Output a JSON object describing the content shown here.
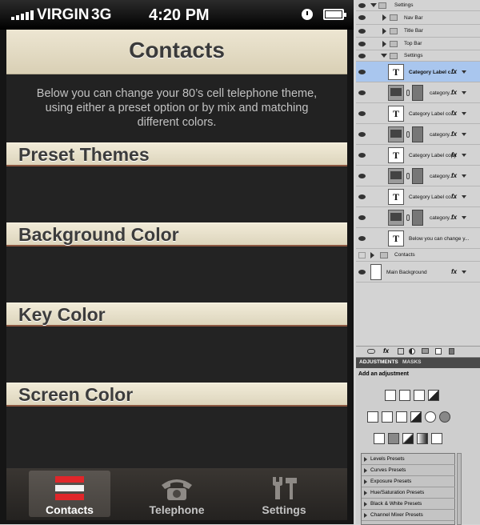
{
  "status_bar": {
    "carrier": "VIRGIN",
    "network": "3G",
    "time": "4:20 PM"
  },
  "nav_bar": {
    "title": "Contacts"
  },
  "intro_text": "Below you can change your 80’s cell telephone theme, using either a preset option or by mix and matching different colors.",
  "categories": [
    {
      "label": "Preset Themes"
    },
    {
      "label": "Background Color"
    },
    {
      "label": "Key Color"
    },
    {
      "label": "Screen Color"
    }
  ],
  "tab_bar": {
    "tabs": [
      {
        "label": "Contacts",
        "icon": "contacts-icon",
        "active": true
      },
      {
        "label": "Telephone",
        "icon": "telephone-icon",
        "active": false
      },
      {
        "label": "Settings",
        "icon": "settings-tools-icon",
        "active": false
      }
    ]
  },
  "layers_panel": {
    "rows": [
      {
        "label": "Settings"
      },
      {
        "label": "Nav Bar"
      },
      {
        "label": "Title Bar"
      },
      {
        "label": "Top Bar"
      },
      {
        "label": "Settings"
      },
      {
        "label": "Category Label c..."
      },
      {
        "label": "category..."
      },
      {
        "label": "Category Label co..."
      },
      {
        "label": "category..."
      },
      {
        "label": "Category Label copy"
      },
      {
        "label": "category..."
      },
      {
        "label": "Category Label co..."
      },
      {
        "label": "category..."
      },
      {
        "label": "Below you can change y..."
      },
      {
        "label": "Contacts"
      },
      {
        "label": "Main Background"
      }
    ],
    "fx_label": "fx"
  },
  "adjustments_panel": {
    "tabs": [
      "ADJUSTMENTS",
      "MASKS"
    ],
    "title": "Add an adjustment",
    "presets": [
      "Levels Presets",
      "Curves Presets",
      "Exposure Presets",
      "Hue/Saturation Presets",
      "Black & White Presets",
      "Channel Mixer Presets"
    ]
  },
  "colors": {
    "nav_bar": "#e6dfc8",
    "category_bar": "#e8e1cc",
    "accent_red": "#e0262a",
    "selected_layer": "#a9c6ee"
  }
}
